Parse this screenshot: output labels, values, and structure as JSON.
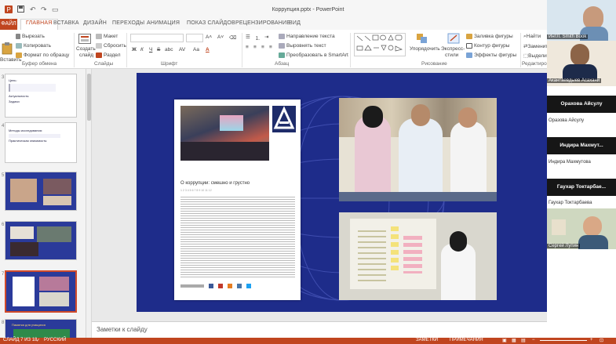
{
  "window": {
    "title": "Коррупция.pptx - PowerPoint"
  },
  "tabs": {
    "file": "ФАЙЛ",
    "items": [
      "ГЛАВНАЯ",
      "ВСТАВКА",
      "ДИЗАЙН",
      "ПЕРЕХОДЫ",
      "АНИМАЦИЯ",
      "ПОКАЗ СЛАЙДОВ",
      "РЕЦЕНЗИРОВАНИЕ",
      "ВИД"
    ],
    "active": "ГЛАВНАЯ"
  },
  "ribbon": {
    "clipboard": {
      "paste": "Вставить",
      "cut": "Вырезать",
      "copy": "Копировать",
      "format": "Формат по образцу",
      "group": "Буфер обмена"
    },
    "slides": {
      "new_slide_1": "Создать",
      "new_slide_2": "слайд",
      "layout": "Макет",
      "reset": "Сбросить",
      "section": "Раздел",
      "group": "Слайды"
    },
    "font": {
      "bold": "Ж",
      "italic": "К",
      "underline": "Ч",
      "strike": "S",
      "shadow": "abc",
      "spacing": "AV",
      "case": "Aa",
      "color": "A",
      "group": "Шрифт"
    },
    "paragraph": {
      "direction": "Направление текста",
      "align": "Выровнять текст",
      "smartart": "Преобразовать в SmartArt",
      "group": "Абзац"
    },
    "drawing": {
      "arrange": "Упорядочить",
      "quick_styles_1": "Экспресс-",
      "quick_styles_2": "стили",
      "fill": "Заливка фигуры",
      "outline": "Контур фигуры",
      "effects": "Эффекты фигуры",
      "group": "Рисование"
    },
    "editing": {
      "find": "Найти",
      "replace": "Заменить",
      "select": "Выделить",
      "group": "Редактирование"
    }
  },
  "thumbnails": {
    "numbers": [
      "3",
      "4",
      "5",
      "6",
      "7",
      "8"
    ],
    "thumb3_lines": [
      "Цель:",
      "Актуальность:",
      "Задачи:"
    ],
    "thumb4_lines": [
      "Методы исследования:",
      "Практическая значимость:"
    ],
    "thumb8_line": "Памятка для учащихся"
  },
  "slide": {
    "article_title": "О коррупции: смешно и грустно",
    "article_meta": "1 2 3 4 5 6 7 8 9 10 11 12"
  },
  "notes": {
    "placeholder": "Заметки к слайду"
  },
  "status": {
    "slide_info": "СЛАЙД 7 ИЗ 18",
    "language": "РУССКИЙ",
    "notes": "ЗАМЕТКИ",
    "comments": "ПРИМЕЧАНИЯ"
  },
  "participants": [
    {
      "name": "ИнтЛ. Smith Book",
      "label": "ИнтЛ. Smith Book"
    },
    {
      "name": "Акантаевдыев Асаханй",
      "label": "Акантаевдыев Асаханй"
    },
    {
      "name": "Орахова Айсулу",
      "label": "Оразова Айсулу"
    },
    {
      "name": "Индира Махмут...",
      "label": "Индира Махмутова"
    },
    {
      "name": "Гаухар Токтарбае...",
      "label": "Гаухар Токтарбаева"
    },
    {
      "name": "Сергей Лупин",
      "label": "Сергей Лупин"
    }
  ],
  "colors": {
    "accent": "#c0451f",
    "slide_bg": "#1e2c8a",
    "ribbon_bg": "#ffffff"
  }
}
